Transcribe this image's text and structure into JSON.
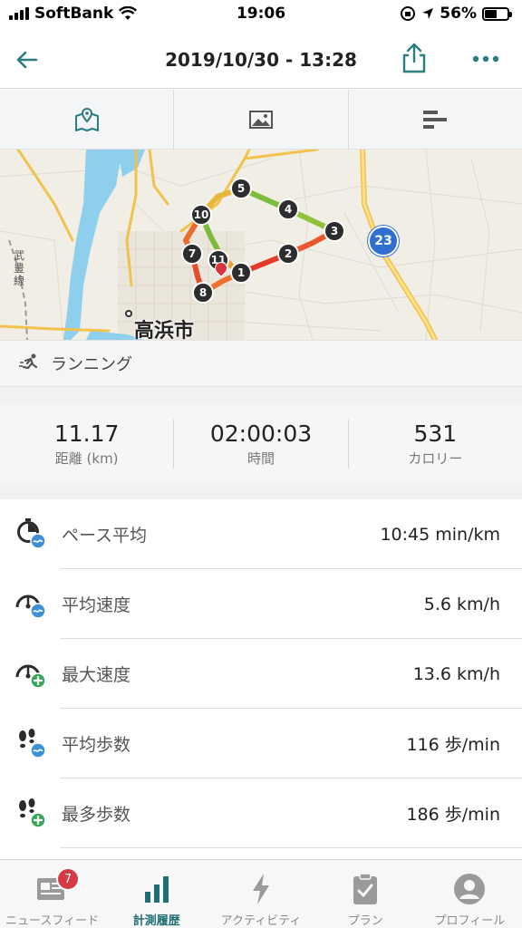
{
  "status_bar": {
    "carrier": "SoftBank",
    "time": "19:06",
    "battery": "56%"
  },
  "nav": {
    "title": "2019/10/30 - 13:28",
    "back_icon": "arrow-left-icon",
    "share_icon": "share-icon",
    "more_icon": "more-dots-icon"
  },
  "view_tabs": [
    {
      "icon": "map-icon",
      "active": true
    },
    {
      "icon": "photo-icon",
      "active": false
    },
    {
      "icon": "bar-chart-icon",
      "active": false
    }
  ],
  "map": {
    "city": "高浜市",
    "vertical_label": "武豊線",
    "route_badge": "23",
    "markers": [
      "1",
      "2",
      "3",
      "4",
      "5",
      "7",
      "8",
      "10",
      "11"
    ]
  },
  "activity": {
    "label": "ランニング",
    "icon": "running-icon"
  },
  "summary": [
    {
      "value": "11.17",
      "label": "距離 (km)"
    },
    {
      "value": "02:00:03",
      "label": "時間"
    },
    {
      "value": "531",
      "label": "カロリー"
    }
  ],
  "stats": [
    {
      "label": "ペース平均",
      "value": "10:45 min/km",
      "icon": "pace-clock-icon"
    },
    {
      "label": "平均速度",
      "value": "5.6 km/h",
      "icon": "speedometer-average-icon"
    },
    {
      "label": "最大速度",
      "value": "13.6 km/h",
      "icon": "speedometer-max-icon"
    },
    {
      "label": "平均歩数",
      "value": "116 歩/min",
      "icon": "footsteps-average-icon"
    },
    {
      "label": "最多歩数",
      "value": "186 歩/min",
      "icon": "footsteps-max-icon"
    }
  ],
  "tab_bar": [
    {
      "label": "ニュースフィード",
      "icon": "newsfeed-icon",
      "badge": "7",
      "active": false
    },
    {
      "label": "計測履歴",
      "icon": "history-chart-icon",
      "active": true
    },
    {
      "label": "アクティビティ",
      "icon": "lightning-icon",
      "active": false
    },
    {
      "label": "プラン",
      "icon": "clipboard-icon",
      "active": false
    },
    {
      "label": "プロフィール",
      "icon": "profile-icon",
      "active": false
    }
  ],
  "colors": {
    "accent": "#1e6f73",
    "badge": "#d63b45",
    "route_fast": "#7cbc3d",
    "route_slow": "#e33b2b"
  }
}
